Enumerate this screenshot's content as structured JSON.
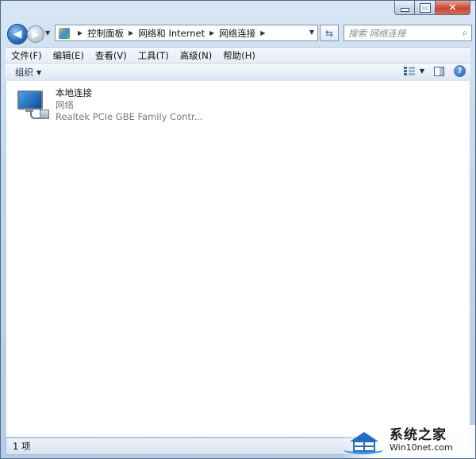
{
  "window": {
    "caption_buttons": {
      "minimize": "minimize",
      "maximize": "maximize",
      "close": "×"
    }
  },
  "navigation": {
    "back_glyph": "◀",
    "forward_glyph": "▶",
    "breadcrumbs": [
      "控制面板",
      "网络和 Internet",
      "网络连接"
    ],
    "search_placeholder": "搜索 网络连接"
  },
  "menu": {
    "items": [
      "文件(F)",
      "编辑(E)",
      "查看(V)",
      "工具(T)",
      "高级(N)",
      "帮助(H)"
    ]
  },
  "command_bar": {
    "organize_label": "组织",
    "help_glyph": "?"
  },
  "content": {
    "items": [
      {
        "name": "本地连接",
        "type": "网络",
        "device": "Realtek PCIe GBE Family Contr..."
      }
    ]
  },
  "status": {
    "count_text": "1 项"
  },
  "watermark": {
    "title": "系统之家",
    "url": "Win10net.com"
  }
}
